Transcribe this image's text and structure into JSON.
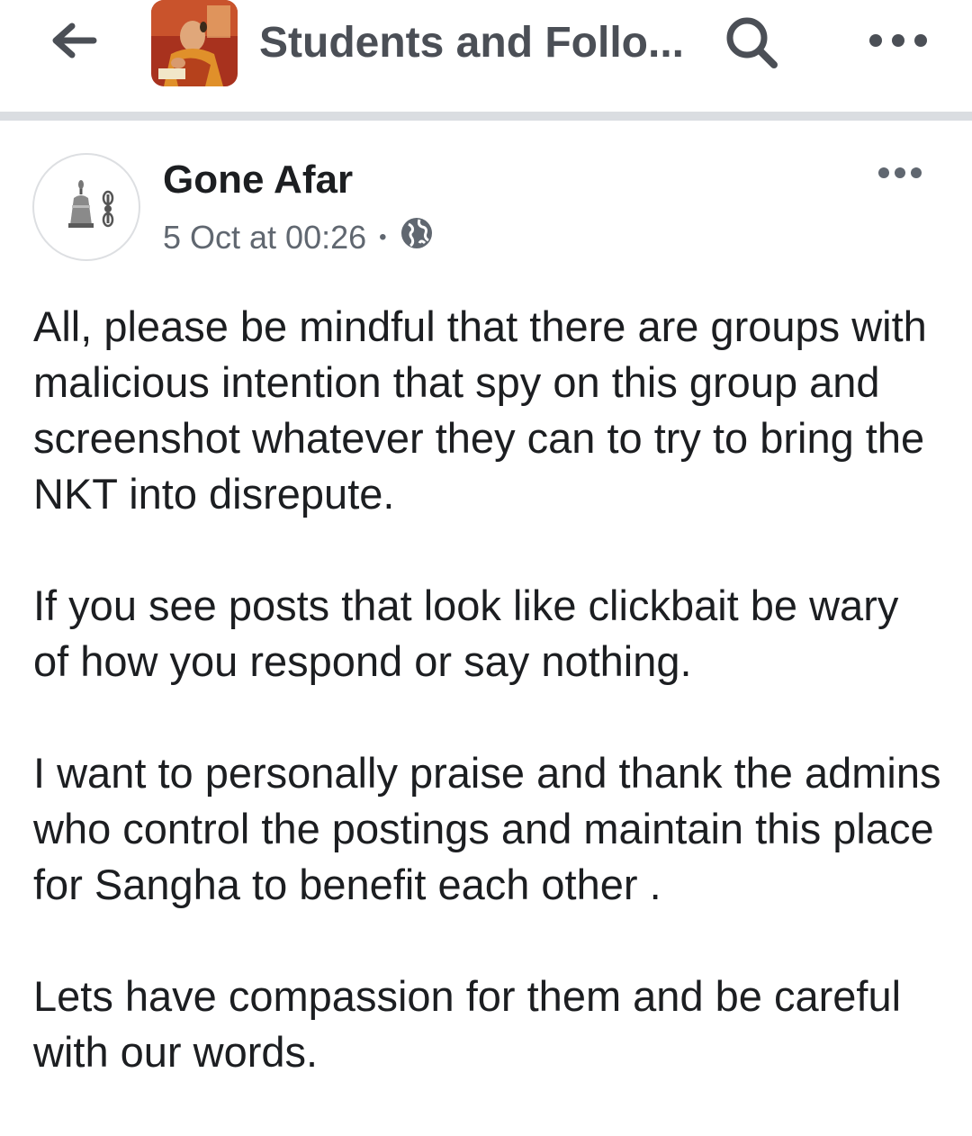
{
  "header": {
    "back_icon": "arrow-left-icon",
    "group_title": "Students and Follo...",
    "search_icon": "search-icon",
    "more_icon": "more-horizontal-icon"
  },
  "post": {
    "author": "Gone Afar",
    "timestamp": "5 Oct at 00:26",
    "separator": "•",
    "audience_icon": "globe-icon",
    "more_icon": "more-horizontal-icon",
    "paragraphs": [
      "All, please be mindful that there are groups with malicious intention that spy on this group and screenshot whatever they can to try to bring the NKT into disrepute.",
      "If you see posts that look like clickbait be wary of how you respond or say nothing.",
      "I want to personally praise and thank the admins who control the postings and maintain this place for Sangha to benefit each other .",
      "Lets have compassion for them and be careful with our words."
    ]
  },
  "colors": {
    "header_text": "#4b4f56",
    "divider": "#dadde1",
    "meta_text": "#606770",
    "body_text": "#1c1e21"
  }
}
